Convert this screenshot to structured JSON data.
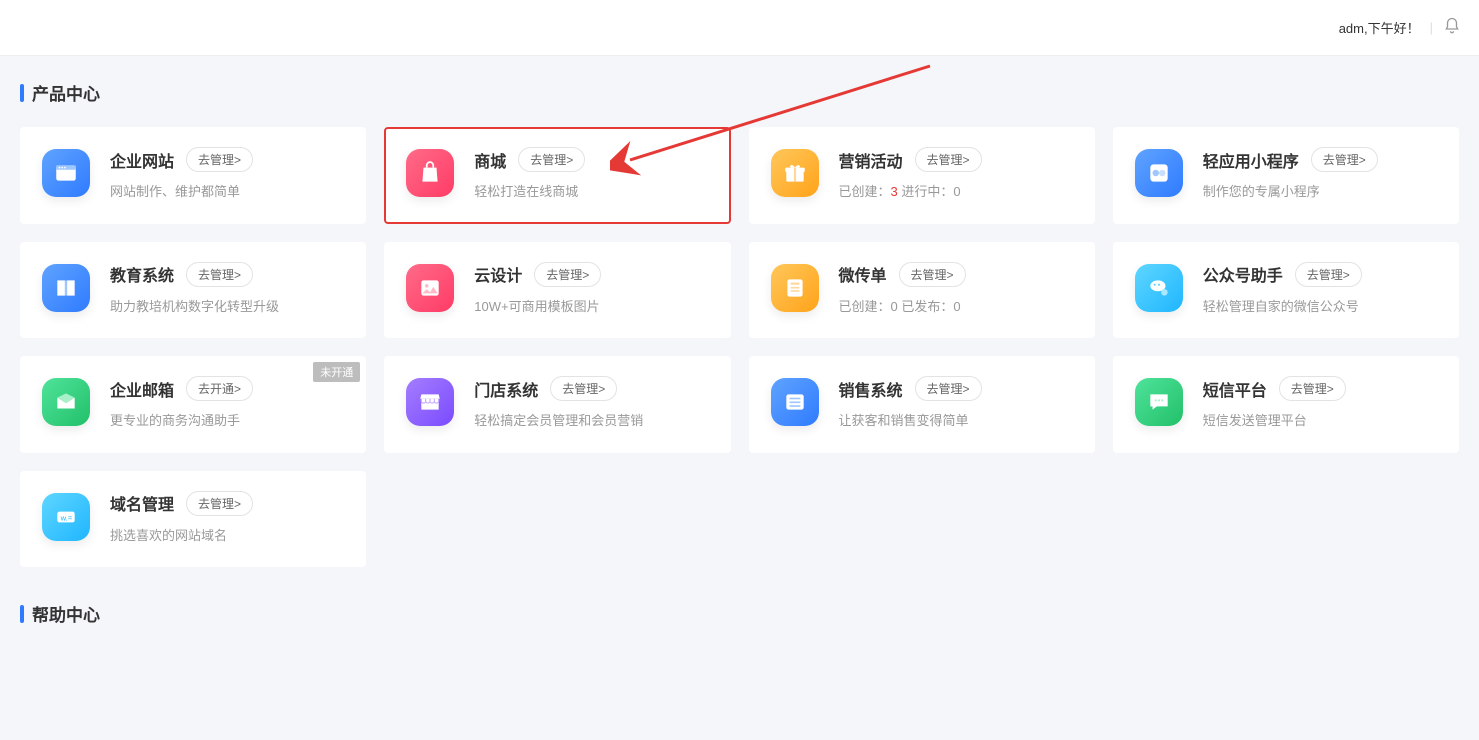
{
  "header": {
    "greeting": "adm,下午好！"
  },
  "sections": {
    "products_title": "产品中心",
    "help_title": "帮助中心"
  },
  "cards": [
    {
      "title": "企业网站",
      "btn": "去管理>",
      "desc": "网站制作、维护都简单",
      "icon": "window-icon",
      "color": "#3d8bff"
    },
    {
      "title": "商城",
      "btn": "去管理>",
      "desc": "轻松打造在线商城",
      "icon": "shopping-bag-icon",
      "color": "#ff4d6d",
      "highlighted": true
    },
    {
      "title": "营销活动",
      "btn": "去管理>",
      "desc_prefix": "已创建：",
      "desc_val": "3",
      "desc_suffix": "   进行中：0",
      "icon": "gift-icon",
      "color": "#ffb020"
    },
    {
      "title": "轻应用小程序",
      "btn": "去管理>",
      "desc": "制作您的专属小程序",
      "icon": "link-icon",
      "color": "#3d8bff"
    },
    {
      "title": "教育系统",
      "btn": "去管理>",
      "desc": "助力教培机构数字化转型升级",
      "icon": "book-icon",
      "color": "#3d8bff"
    },
    {
      "title": "云设计",
      "btn": "去管理>",
      "desc": "10W+可商用模板图片",
      "icon": "image-icon",
      "color": "#ff4d6d"
    },
    {
      "title": "微传单",
      "btn": "去管理>",
      "desc": "已创建：0   已发布：0",
      "icon": "flyer-icon",
      "color": "#ffb020"
    },
    {
      "title": "公众号助手",
      "btn": "去管理>",
      "desc": "轻松管理自家的微信公众号",
      "icon": "wechat-icon",
      "color": "#22c3ff"
    },
    {
      "title": "企业邮箱",
      "btn": "去开通>",
      "desc": "更专业的商务沟通助手",
      "icon": "mail-icon",
      "color": "#2ecc71",
      "badge": "未开通"
    },
    {
      "title": "门店系统",
      "btn": "去管理>",
      "desc": "轻松搞定会员管理和会员营销",
      "icon": "store-icon",
      "color": "#8e5cff"
    },
    {
      "title": "销售系统",
      "btn": "去管理>",
      "desc": "让获客和销售变得简单",
      "icon": "list-icon",
      "color": "#3d8bff"
    },
    {
      "title": "短信平台",
      "btn": "去管理>",
      "desc": "短信发送管理平台",
      "icon": "sms-icon",
      "color": "#2ecc71"
    },
    {
      "title": "域名管理",
      "btn": "去管理>",
      "desc": "挑选喜欢的网站域名",
      "icon": "domain-icon",
      "color": "#22c3ff"
    }
  ]
}
